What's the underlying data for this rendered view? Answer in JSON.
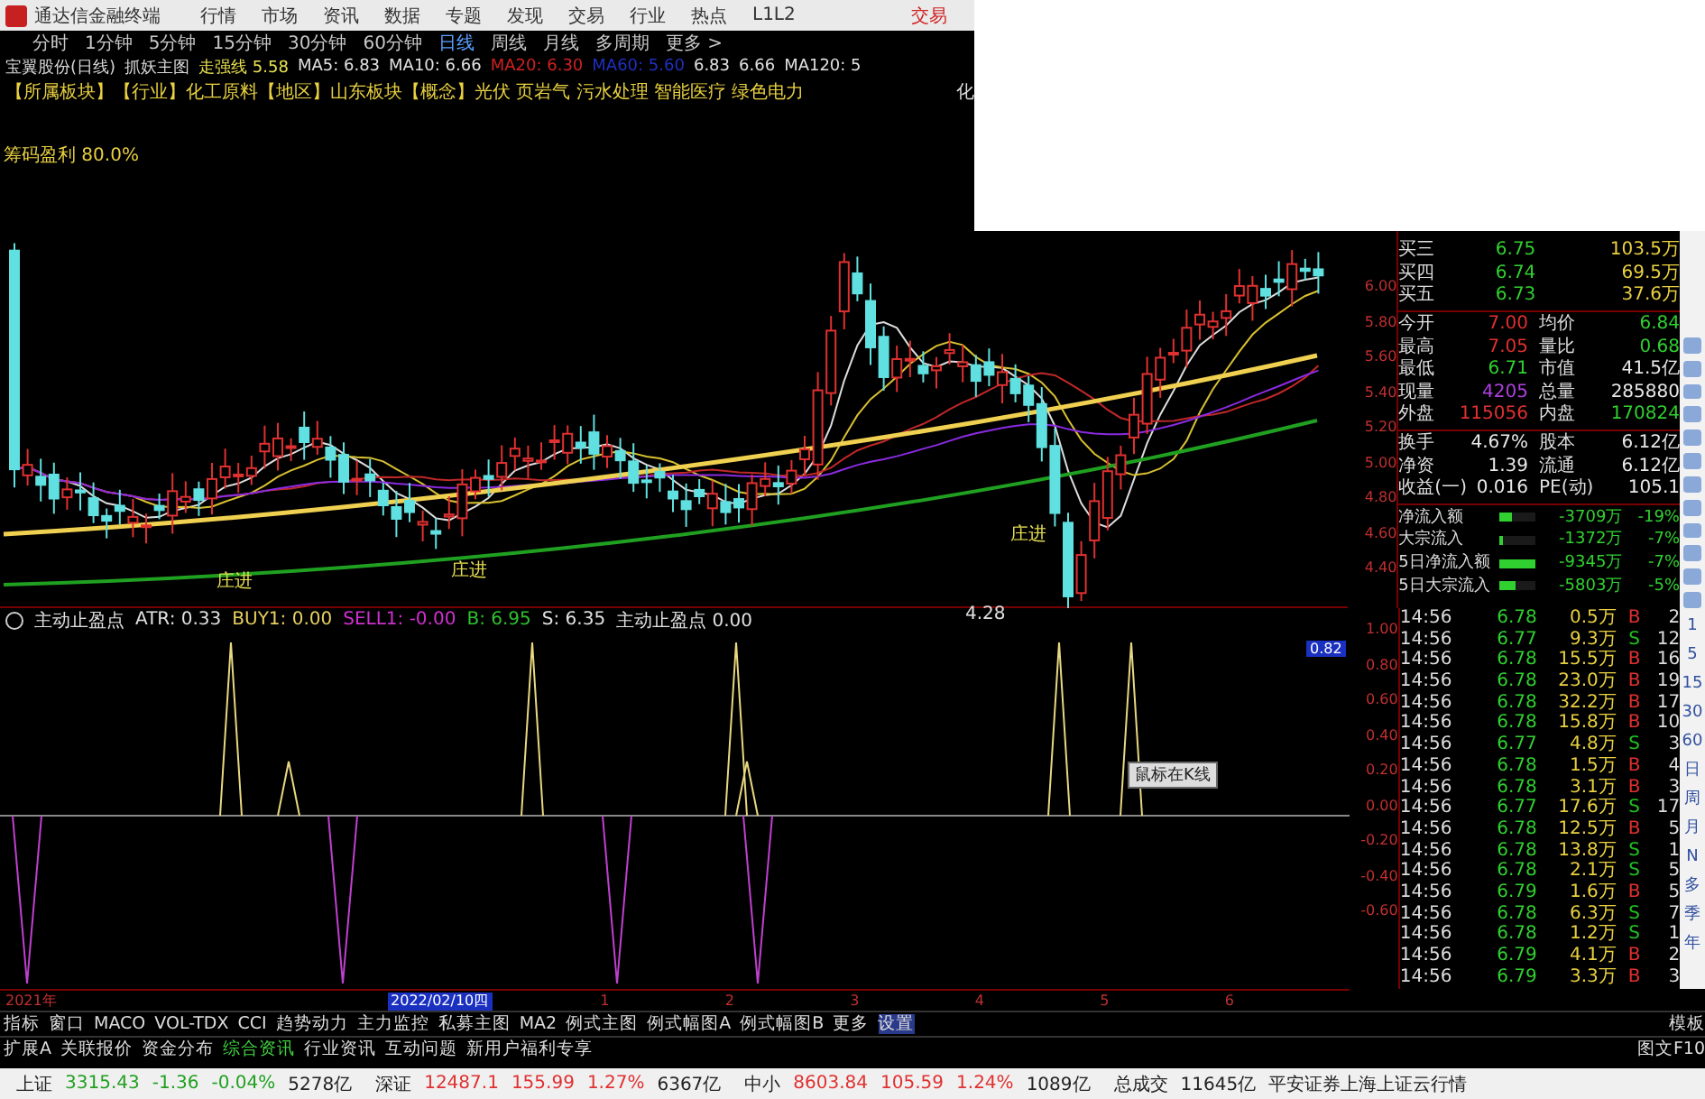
{
  "app": {
    "title": "通达信金融终端",
    "menu": [
      "行情",
      "市场",
      "资讯",
      "数据",
      "专题",
      "发现",
      "交易",
      "行业",
      "热点",
      "L1L2"
    ],
    "trade_link": "交易"
  },
  "periods": [
    {
      "label": "分时",
      "selected": false
    },
    {
      "label": "1分钟",
      "selected": false
    },
    {
      "label": "5分钟",
      "selected": false
    },
    {
      "label": "15分钟",
      "selected": false
    },
    {
      "label": "30分钟",
      "selected": false
    },
    {
      "label": "60分钟",
      "selected": false
    },
    {
      "label": "日线",
      "selected": true
    },
    {
      "label": "周线",
      "selected": false
    },
    {
      "label": "月线",
      "selected": false
    },
    {
      "label": "多周期",
      "selected": false
    },
    {
      "label": "更多 >",
      "selected": false
    }
  ],
  "info_line": [
    {
      "text": "宝翼股份(日线)",
      "color": "#d8d8d8"
    },
    {
      "text": "抓妖主图",
      "color": "#d8d8d8"
    },
    {
      "text": "走强线 5.58",
      "color": "#e8e050"
    },
    {
      "text": "MA5: 6.83",
      "color": "#e0e0e0"
    },
    {
      "text": "MA10: 6.66",
      "color": "#e0e0e0"
    },
    {
      "text": "MA20: 6.30",
      "color": "#d02020"
    },
    {
      "text": "MA60: 5.60",
      "color": "#2030c0"
    },
    {
      "text": "6.83",
      "color": "#e0e0e0"
    },
    {
      "text": "6.66",
      "color": "#e0e0e0"
    },
    {
      "text": "MA120: 5",
      "color": "#e0e0e0"
    }
  ],
  "sector_line": "【所属板块】【行业】化工原料【地区】山东板块【概念】光伏 页岩气 污水处理 智能医疗 绿色电力",
  "sector_more": "化",
  "main_chart": {
    "label": "筹码盈利 80.0%",
    "price_axis": [
      "6.00",
      "5.80",
      "5.60",
      "5.40",
      "5.20",
      "5.00",
      "4.80",
      "4.60",
      "4.40"
    ],
    "markers": [
      {
        "text": "庄进",
        "kind": "entry"
      },
      {
        "text": "庄进",
        "kind": "entry"
      },
      {
        "text": "庄进",
        "kind": "entry"
      },
      {
        "text": "4.28",
        "kind": "low"
      }
    ]
  },
  "quote": {
    "bids": [
      {
        "name": "买三",
        "price": "6.75",
        "volume": "103.5万"
      },
      {
        "name": "买四",
        "price": "6.74",
        "volume": "69.5万"
      },
      {
        "name": "买五",
        "price": "6.73",
        "volume": "37.6万"
      }
    ],
    "stats": [
      {
        "l1": "今开",
        "v1": "7.00",
        "l2": "均价",
        "v2": "6.84"
      },
      {
        "l1": "最高",
        "v1": "7.05",
        "l2": "量比",
        "v2": "0.68"
      },
      {
        "l1": "最低",
        "v1": "6.71",
        "l2": "市值",
        "v2": "41.5亿"
      },
      {
        "l1": "现量",
        "v1": "4205",
        "l2": "总量",
        "v2": "285880"
      },
      {
        "l1": "外盘",
        "v1": "115056",
        "l2": "内盘",
        "v2": "170824"
      }
    ],
    "stats2": [
      {
        "l1": "换手",
        "v1": "4.67%",
        "l2": "股本",
        "v2": "6.12亿"
      },
      {
        "l1": "净资",
        "v1": "1.39",
        "l2": "流通",
        "v2": "6.12亿"
      },
      {
        "l1": "收益(一)",
        "v1": "0.016",
        "l2": "PE(动)",
        "v2": "105.1"
      }
    ],
    "flows": [
      {
        "name": "净流入额",
        "level": 0.35,
        "amount": "-3709万",
        "pct": "-19%"
      },
      {
        "name": "大宗流入",
        "level": 0.1,
        "amount": "-1372万",
        "pct": "-7%"
      },
      {
        "name": "5日净流入额",
        "level": 1.0,
        "amount": "-9345万",
        "pct": "-7%"
      },
      {
        "name": "5日大宗流入",
        "level": 0.45,
        "amount": "-5803万",
        "pct": "-5%"
      }
    ]
  },
  "ticks": [
    {
      "time": "14:56",
      "price": "6.78",
      "volume": "0.5万",
      "side": "B",
      "kind": "buy",
      "count": "2"
    },
    {
      "time": "14:56",
      "price": "6.77",
      "volume": "9.3万",
      "side": "S",
      "kind": "sell",
      "count": "12"
    },
    {
      "time": "14:56",
      "price": "6.78",
      "volume": "15.5万",
      "side": "B",
      "kind": "buy",
      "count": "16"
    },
    {
      "time": "14:56",
      "price": "6.78",
      "volume": "23.0万",
      "side": "B",
      "kind": "buy",
      "count": "19"
    },
    {
      "time": "14:56",
      "price": "6.78",
      "volume": "32.2万",
      "side": "B",
      "kind": "buy",
      "count": "17"
    },
    {
      "time": "14:56",
      "price": "6.78",
      "volume": "15.8万",
      "side": "B",
      "kind": "buy",
      "count": "10"
    },
    {
      "time": "14:56",
      "price": "6.77",
      "volume": "4.8万",
      "side": "S",
      "kind": "sell",
      "count": "3"
    },
    {
      "time": "14:56",
      "price": "6.78",
      "volume": "1.5万",
      "side": "B",
      "kind": "buy",
      "count": "4"
    },
    {
      "time": "14:56",
      "price": "6.78",
      "volume": "3.1万",
      "side": "B",
      "kind": "buy",
      "count": "3"
    },
    {
      "time": "14:56",
      "price": "6.77",
      "volume": "17.6万",
      "side": "S",
      "kind": "sell",
      "count": "17"
    },
    {
      "time": "14:56",
      "price": "6.78",
      "volume": "12.5万",
      "side": "B",
      "kind": "buy",
      "count": "5"
    },
    {
      "time": "14:56",
      "price": "6.78",
      "volume": "13.8万",
      "side": "S",
      "kind": "sell",
      "count": "1"
    },
    {
      "time": "14:56",
      "price": "6.78",
      "volume": "2.1万",
      "side": "S",
      "kind": "sell",
      "count": "5"
    },
    {
      "time": "14:56",
      "price": "6.79",
      "volume": "1.6万",
      "side": "B",
      "kind": "buy",
      "count": "5"
    },
    {
      "time": "14:56",
      "price": "6.78",
      "volume": "6.3万",
      "side": "S",
      "kind": "sell",
      "count": "7"
    },
    {
      "time": "14:56",
      "price": "6.78",
      "volume": "1.2万",
      "side": "S",
      "kind": "sell",
      "count": "1"
    },
    {
      "time": "14:56",
      "price": "6.79",
      "volume": "4.1万",
      "side": "B",
      "kind": "buy",
      "count": "2"
    },
    {
      "time": "14:56",
      "price": "6.79",
      "volume": "3.3万",
      "side": "B",
      "kind": "buy",
      "count": "3"
    }
  ],
  "period_toolbar": [
    "1",
    "5",
    "15",
    "30",
    "60",
    "日",
    "周",
    "月",
    "N",
    "多",
    "季",
    "年"
  ],
  "indicator": {
    "legend": [
      {
        "text": "主动止盈点",
        "color": "#e0e0e0"
      },
      {
        "text": "ATR: 0.33",
        "color": "#e0e0e0"
      },
      {
        "text": "BUY1: 0.00",
        "color": "#e8d060"
      },
      {
        "text": "SELL1: -0.00",
        "color": "#d030d0"
      },
      {
        "text": "B: 6.95",
        "color": "#30c030"
      },
      {
        "text": "S: 6.35",
        "color": "#e0e0e0"
      },
      {
        "text": "主动止盈点 0.00",
        "color": "#e0e0e0"
      }
    ],
    "axis": [
      "1.00",
      "0.80",
      "0.60",
      "0.40",
      "0.20",
      "0.00",
      "-0.20",
      "-0.40",
      "-0.60"
    ],
    "cursor_value": "0.82",
    "popup": "鼠标在K线"
  },
  "date_axis": {
    "year": "2021年",
    "date": "2022/02/10四",
    "months": [
      "1",
      "2",
      "3",
      "4",
      "5",
      "6"
    ]
  },
  "tabs": [
    {
      "label": "指标",
      "selected": false
    },
    {
      "label": "窗口",
      "selected": false
    },
    {
      "label": "MACO",
      "selected": false
    },
    {
      "label": "VOL-TDX",
      "selected": false
    },
    {
      "label": "CCI",
      "selected": false
    },
    {
      "label": "趋势动力",
      "selected": false
    },
    {
      "label": "主力监控",
      "selected": false
    },
    {
      "label": "私募主图",
      "selected": false
    },
    {
      "label": "MA2",
      "selected": false
    },
    {
      "label": "例式主图",
      "selected": false
    },
    {
      "label": "例式幅图A",
      "selected": false
    },
    {
      "label": "例式幅图B",
      "selected": false
    },
    {
      "label": "更多",
      "selected": false
    },
    {
      "label": "设置",
      "selected": true
    }
  ],
  "tabs_right": "模板",
  "tabs2": [
    {
      "label": "扩展A",
      "selected": false
    },
    {
      "label": "关联报价",
      "selected": false
    },
    {
      "label": "资金分布",
      "selected": false
    },
    {
      "label": "综合资讯",
      "selected": true
    },
    {
      "label": "行业资讯",
      "selected": false
    },
    {
      "label": "互动问题",
      "selected": false
    },
    {
      "label": "新用户福利专享",
      "selected": false
    }
  ],
  "tabs2_right": "图文F10",
  "status_bar": [
    {
      "name": "上证",
      "value": "3315.43",
      "change": "-1.36",
      "pct": "-0.04%",
      "amount": "5278亿",
      "color": "#20a020"
    },
    {
      "name": "深证",
      "value": "12487.1",
      "change": "155.99",
      "pct": "1.27%",
      "amount": "6367亿",
      "color": "#e03030"
    },
    {
      "name": "中小",
      "value": "8603.84",
      "change": "105.59",
      "pct": "1.24%",
      "amount": "1089亿",
      "color": "#e03030"
    }
  ],
  "total": {
    "label": "总成交",
    "amount": "11645亿",
    "source": "平安证券上海上证云行情"
  }
}
